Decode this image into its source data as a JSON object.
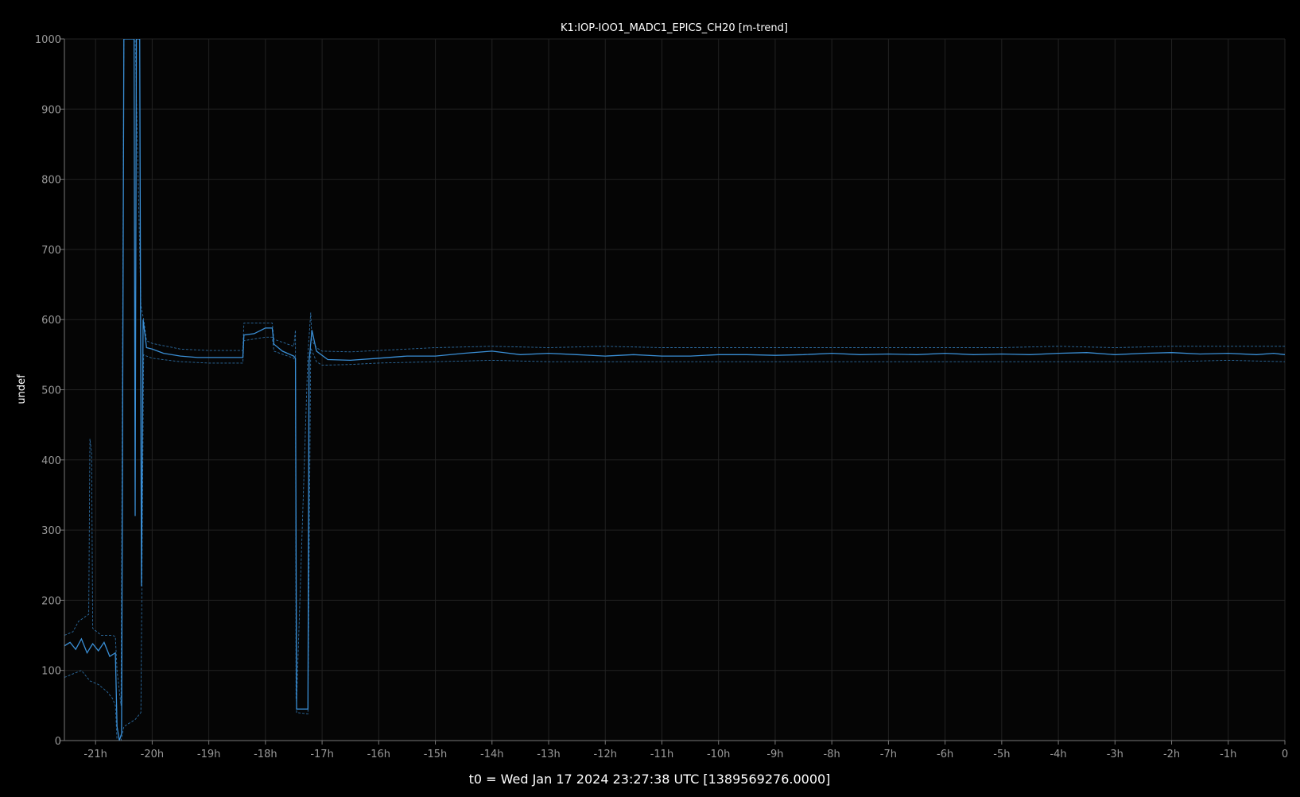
{
  "chart_data": {
    "type": "line",
    "title": "K1:IOP-IOO1_MADC1_EPICS_CH20 [m-trend]",
    "xlabel": "t0 = Wed Jan 17 2024 23:27:38 UTC [1389569276.0000]",
    "ylabel": "undef",
    "xlim": [
      -21.55,
      0
    ],
    "ylim": [
      0,
      1000
    ],
    "x_unit": "hours relative to t0",
    "xtick_labels": [
      "-21h",
      "-20h",
      "-19h",
      "-18h",
      "-17h",
      "-16h",
      "-15h",
      "-14h",
      "-13h",
      "-12h",
      "-11h",
      "-10h",
      "-9h",
      "-8h",
      "-7h",
      "-6h",
      "-5h",
      "-4h",
      "-3h",
      "-2h",
      "-1h",
      "0"
    ],
    "xticks": [
      -21,
      -20,
      -19,
      -18,
      -17,
      -16,
      -15,
      -14,
      -13,
      -12,
      -11,
      -10,
      -9,
      -8,
      -7,
      -6,
      -5,
      -4,
      -3,
      -2,
      -1,
      0
    ],
    "ytick_labels": [
      "0",
      "100",
      "200",
      "300",
      "400",
      "500",
      "600",
      "700",
      "800",
      "900",
      "1000"
    ],
    "yticks": [
      0,
      100,
      200,
      300,
      400,
      500,
      600,
      700,
      800,
      900,
      1000
    ],
    "grid": true,
    "colors": {
      "background": "#050505",
      "series": "#3a8fd6",
      "grid": "#222222",
      "axis": "#777777",
      "tick_text": "#9a9a9a",
      "text": "#ffffff"
    },
    "series": [
      {
        "role": "mean",
        "style": "solid",
        "x": [
          -21.55,
          -21.45,
          -21.35,
          -21.25,
          -21.15,
          -21.05,
          -20.95,
          -20.85,
          -20.75,
          -20.65,
          -20.62,
          -20.58,
          -20.54,
          -20.5,
          -20.47,
          -20.44,
          -20.4,
          -20.36,
          -20.32,
          -20.3,
          -20.28,
          -20.25,
          -20.22,
          -20.19,
          -20.16,
          -20.1,
          -20.0,
          -19.8,
          -19.5,
          -19.2,
          -18.9,
          -18.4,
          -18.38,
          -18.2,
          -18.0,
          -17.88,
          -17.85,
          -17.7,
          -17.5,
          -17.47,
          -17.45,
          -17.25,
          -17.23,
          -17.18,
          -17.1,
          -16.9,
          -16.5,
          -16.0,
          -15.5,
          -15.0,
          -14.5,
          -14.0,
          -13.5,
          -13.0,
          -12.5,
          -12.0,
          -11.5,
          -11.0,
          -10.5,
          -10.0,
          -9.5,
          -9.0,
          -8.5,
          -8.0,
          -7.5,
          -7.0,
          -6.5,
          -6.0,
          -5.5,
          -5.0,
          -4.5,
          -4.0,
          -3.5,
          -3.0,
          -2.5,
          -2.0,
          -1.5,
          -1.0,
          -0.5,
          -0.2,
          0.0
        ],
        "y": [
          135,
          140,
          130,
          145,
          125,
          138,
          128,
          140,
          120,
          125,
          20,
          0,
          10,
          1000,
          1000,
          1000,
          1000,
          1000,
          1000,
          320,
          1000,
          1000,
          1000,
          220,
          600,
          560,
          558,
          552,
          548,
          546,
          546,
          546,
          578,
          580,
          588,
          588,
          565,
          555,
          548,
          545,
          45,
          45,
          540,
          585,
          555,
          543,
          542,
          545,
          548,
          548,
          552,
          555,
          550,
          552,
          550,
          548,
          550,
          548,
          548,
          550,
          550,
          549,
          550,
          552,
          550,
          551,
          550,
          552,
          550,
          551,
          550,
          552,
          553,
          550,
          552,
          553,
          551,
          552,
          550,
          552,
          550
        ]
      },
      {
        "role": "max",
        "style": "dashed",
        "x": [
          -21.55,
          -21.4,
          -21.3,
          -21.12,
          -21.1,
          -21.07,
          -21.05,
          -20.9,
          -20.7,
          -20.65,
          -20.62,
          -20.55,
          -20.5,
          -20.3,
          -20.2,
          -20.15,
          -20.1,
          -20.0,
          -19.5,
          -19.0,
          -18.4,
          -18.38,
          -18.0,
          -17.88,
          -17.85,
          -17.5,
          -17.47,
          -17.46,
          -17.45,
          -17.25,
          -17.2,
          -17.18,
          -17.1,
          -17.0,
          -16.5,
          -16.0,
          -15.0,
          -14.0,
          -13.0,
          -12.0,
          -11.0,
          -10.0,
          -9.0,
          -8.0,
          -7.0,
          -6.0,
          -5.0,
          -4.0,
          -3.0,
          -2.0,
          -1.0,
          0.0
        ],
        "y": [
          150,
          155,
          170,
          180,
          430,
          410,
          160,
          150,
          150,
          148,
          100,
          50,
          1000,
          1000,
          620,
          600,
          570,
          566,
          558,
          556,
          556,
          595,
          595,
          595,
          572,
          562,
          585,
          60,
          55,
          552,
          610,
          570,
          560,
          555,
          554,
          556,
          560,
          562,
          560,
          562,
          560,
          560,
          560,
          560,
          560,
          560,
          560,
          562,
          560,
          562,
          562,
          562
        ]
      },
      {
        "role": "min",
        "style": "dashed",
        "x": [
          -21.55,
          -21.4,
          -21.25,
          -21.1,
          -20.95,
          -20.8,
          -20.7,
          -20.65,
          -20.62,
          -20.55,
          -20.5,
          -20.3,
          -20.2,
          -20.15,
          -20.1,
          -20.0,
          -19.5,
          -19.0,
          -18.4,
          -18.38,
          -18.0,
          -17.88,
          -17.85,
          -17.5,
          -17.47,
          -17.45,
          -17.25,
          -17.2,
          -17.1,
          -17.0,
          -16.5,
          -16.0,
          -15.0,
          -14.0,
          -13.0,
          -12.0,
          -11.0,
          -10.0,
          -9.0,
          -8.0,
          -7.0,
          -6.0,
          -5.0,
          -4.0,
          -3.0,
          -2.0,
          -1.0,
          0.0
        ],
        "y": [
          90,
          95,
          100,
          85,
          80,
          70,
          60,
          50,
          0,
          0,
          20,
          30,
          40,
          550,
          548,
          545,
          540,
          538,
          538,
          570,
          575,
          575,
          555,
          545,
          540,
          40,
          38,
          560,
          540,
          535,
          536,
          538,
          540,
          542,
          540,
          540,
          540,
          540,
          540,
          540,
          540,
          540,
          540,
          540,
          540,
          540,
          542,
          540
        ]
      }
    ]
  }
}
